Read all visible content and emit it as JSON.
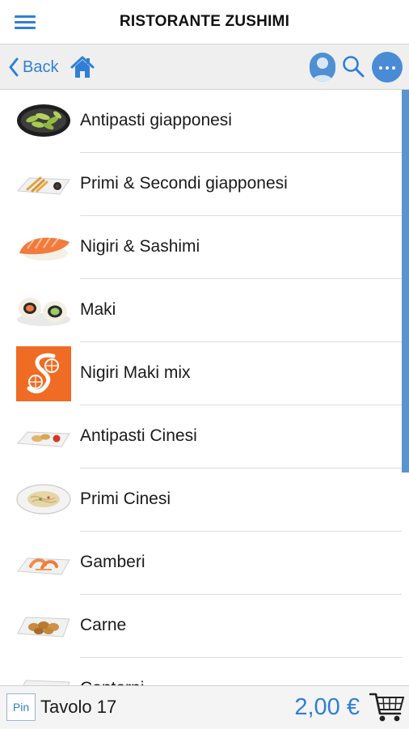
{
  "header": {
    "title": "RISTORANTE ZUSHIMI"
  },
  "nav": {
    "back_label": "Back"
  },
  "categories": [
    {
      "label": "Antipasti giapponesi"
    },
    {
      "label": "Primi & Secondi giapponesi"
    },
    {
      "label": "Nigiri & Sashimi"
    },
    {
      "label": "Maki"
    },
    {
      "label": "Nigiri Maki mix"
    },
    {
      "label": "Antipasti Cinesi"
    },
    {
      "label": "Primi Cinesi"
    },
    {
      "label": "Gamberi"
    },
    {
      "label": "Carne"
    },
    {
      "label": "Contorni"
    }
  ],
  "footer": {
    "pin_label": "Pin",
    "table_label": "Tavolo 17",
    "total": "2,00 €"
  },
  "colors": {
    "accent": "#2f7fd8",
    "scrollbar": "#5b93cf",
    "nigiri_maki_tile": "#f06b23"
  },
  "icons": {
    "menu": "hamburger-icon",
    "back": "chevron-left-icon",
    "home": "home-icon",
    "user": "user-icon",
    "search": "search-icon",
    "more": "more-icon",
    "cart": "cart-icon"
  }
}
